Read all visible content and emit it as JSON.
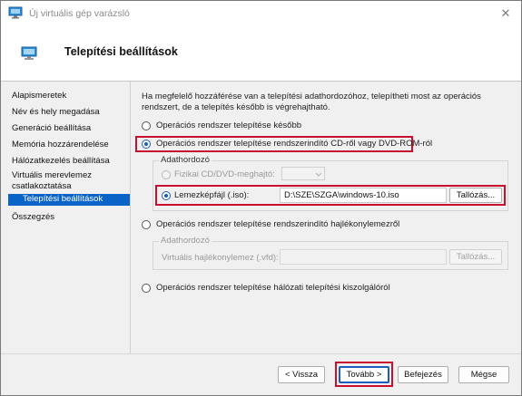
{
  "window": {
    "title": "Új virtuális gép varázsló",
    "close_glyph": "✕",
    "icon": "virtual-machine-icon"
  },
  "header": {
    "title": "Telepítési beállítások",
    "icon": "monitor-icon"
  },
  "sidebar": {
    "items": [
      {
        "label": "Alapismeretek"
      },
      {
        "label": "Név és hely megadása"
      },
      {
        "label": "Generáció beállítása"
      },
      {
        "label": "Memória hozzárendelése"
      },
      {
        "label": "Hálózatkezelés beállítása"
      },
      {
        "label": "Virtuális merevlemez csatlakoztatása"
      },
      {
        "label": "Telepítési beállítások"
      },
      {
        "label": "Összegzés"
      }
    ],
    "active_index": 6
  },
  "content": {
    "intro": "Ha megfelelő hozzáférése van a telepítési adathordozóhoz, telepítheti most az operációs rendszert, de a telepítés később is végrehajtható.",
    "options": {
      "later": "Operációs rendszer telepítése később",
      "cd": "Operációs rendszer telepítése rendszerindító CD-ről vagy DVD-ROM-ról",
      "floppy": "Operációs rendszer telepítése rendszerindító hajlékonylemezről",
      "network": "Operációs rendszer telepítése hálózati telepítési kiszolgálóról"
    },
    "selected_option": "cd",
    "cd_group": {
      "title": "Adathordozó",
      "physical_label": "Fizikai CD/DVD-meghajtó:",
      "image_label": "Lemezképfájl (.iso):",
      "image_path": "D:\\SZE\\SZGA\\windows-10.iso",
      "browse_label": "Tallózás..."
    },
    "floppy_group": {
      "title": "Adathordozó",
      "vfd_label": "Virtuális hajlékonylemez (.vfd):",
      "browse_label": "Tallózás..."
    }
  },
  "footer": {
    "back_label": "< Vissza",
    "next_label": "Tovább >",
    "finish_label": "Befejezés",
    "cancel_label": "Mégse"
  },
  "colors": {
    "highlight": "#c8102e",
    "accent": "#0a64c8"
  }
}
